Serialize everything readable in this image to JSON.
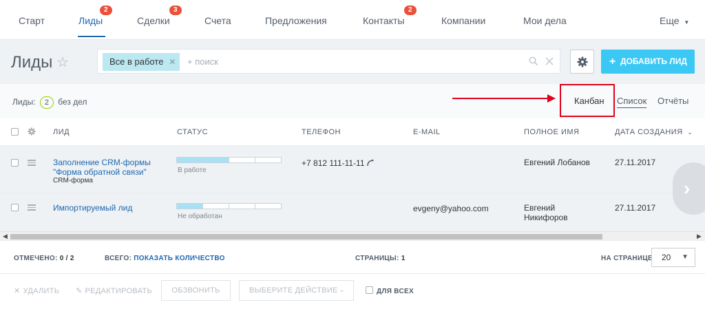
{
  "nav": {
    "items": [
      {
        "label": "Старт"
      },
      {
        "label": "Лиды",
        "badge": "2"
      },
      {
        "label": "Сделки",
        "badge": "3"
      },
      {
        "label": "Счета"
      },
      {
        "label": "Предложения"
      },
      {
        "label": "Контакты",
        "badge": "2"
      },
      {
        "label": "Компании"
      },
      {
        "label": "Мои дела"
      }
    ],
    "more_label": "Еще"
  },
  "header": {
    "title": "Лиды",
    "filter_tag": "Все в работе",
    "search_placeholder": "+ поиск",
    "add_button": "ДОБАВИТЬ ЛИД"
  },
  "summary": {
    "prefix": "Лиды:",
    "count": "2",
    "suffix": "без дел"
  },
  "views": {
    "kanban": "Канбан",
    "list": "Список",
    "reports": "Отчёты"
  },
  "table": {
    "headers": [
      "ЛИД",
      "СТАТУС",
      "ТЕЛЕФОН",
      "E-MAIL",
      "ПОЛНОЕ ИМЯ",
      "ДАТА СОЗДАНИЯ"
    ],
    "rows": [
      {
        "lead_line1": "Заполнение CRM-формы",
        "lead_line2": "\"Форма обратной связи\"",
        "source": "CRM-форма",
        "status": "В работе",
        "status_progress": 0.5,
        "phone": "+7 812 111-11-11",
        "email": "",
        "name_line1": "Евгений Лобанов",
        "name_line2": "",
        "date": "27.11.2017"
      },
      {
        "lead_line1": "Импортируемый лид",
        "lead_line2": "",
        "source": "",
        "status": "Не обработан",
        "status_progress": 0.25,
        "phone": "",
        "email": "evgeny@yahoo.com",
        "name_line1": "Евгений",
        "name_line2": "Никифоров",
        "date": "27.11.2017"
      }
    ]
  },
  "footer": {
    "selected_label": "ОТМЕЧЕНО:",
    "selected_value": "0 / 2",
    "total_label": "ВСЕГО:",
    "total_link": "ПОКАЗАТЬ КОЛИЧЕСТВО",
    "pages_label": "СТРАНИЦЫ:",
    "pages_value": "1",
    "per_page_label": "НА СТРАНИЦЕ:",
    "per_page_value": "20"
  },
  "actions": {
    "delete": "УДАЛИТЬ",
    "edit": "РЕДАКТИРОВАТЬ",
    "call": "ОБЗВОНИТЬ",
    "choose": "ВЫБЕРИТЕ ДЕЙСТВИЕ",
    "for_all": "ДЛЯ ВСЕХ"
  },
  "colors": {
    "accent": "#2067b0",
    "add_button": "#3bc8f5",
    "badge": "#e9513a",
    "highlight": "#e0001a",
    "status_fill": "#a8e1f5"
  }
}
